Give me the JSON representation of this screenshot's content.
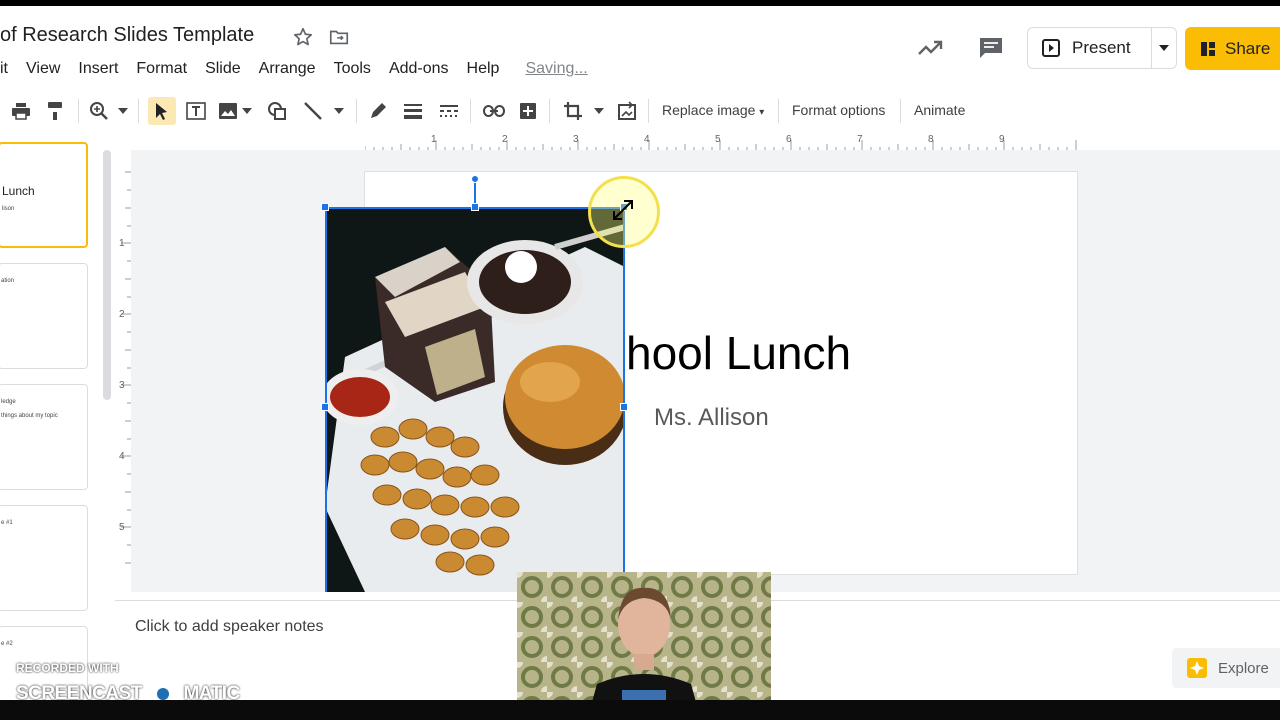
{
  "document": {
    "title": "of Research Slides Template"
  },
  "menu": {
    "items": [
      "it",
      "View",
      "Insert",
      "Format",
      "Slide",
      "Arrange",
      "Tools",
      "Add-ons",
      "Help"
    ],
    "status": "Saving..."
  },
  "header": {
    "present_label": "Present",
    "share_label": "Share"
  },
  "toolbar": {
    "replace_image": "Replace image",
    "format_options": "Format options",
    "animate": "Animate"
  },
  "ruler": {
    "ticks": [
      "1",
      "2",
      "3",
      "4",
      "5",
      "6",
      "7",
      "8",
      "9"
    ],
    "left_ticks": [
      "1",
      "2",
      "3",
      "4",
      "5"
    ]
  },
  "filmstrip": {
    "thumbs": [
      {
        "title": "Lunch",
        "sub": "lison"
      },
      {
        "title": "ation",
        "sub": ""
      },
      {
        "title": "ledge",
        "sub": "things about my topic"
      },
      {
        "title": "e #1",
        "sub": ""
      },
      {
        "title": "e #2",
        "sub": ""
      }
    ]
  },
  "slide": {
    "title": "hool Lunch",
    "subtitle": "Ms. Allison"
  },
  "notes": {
    "placeholder": "Click to add speaker notes"
  },
  "explore": {
    "label": "Explore"
  },
  "watermark": {
    "line1": "RECORDED WITH",
    "line2": "SCREENCAST",
    "line3": "MATIC"
  },
  "colors": {
    "accent_yellow": "#fbbc04",
    "selection_blue": "#1a73e8"
  }
}
